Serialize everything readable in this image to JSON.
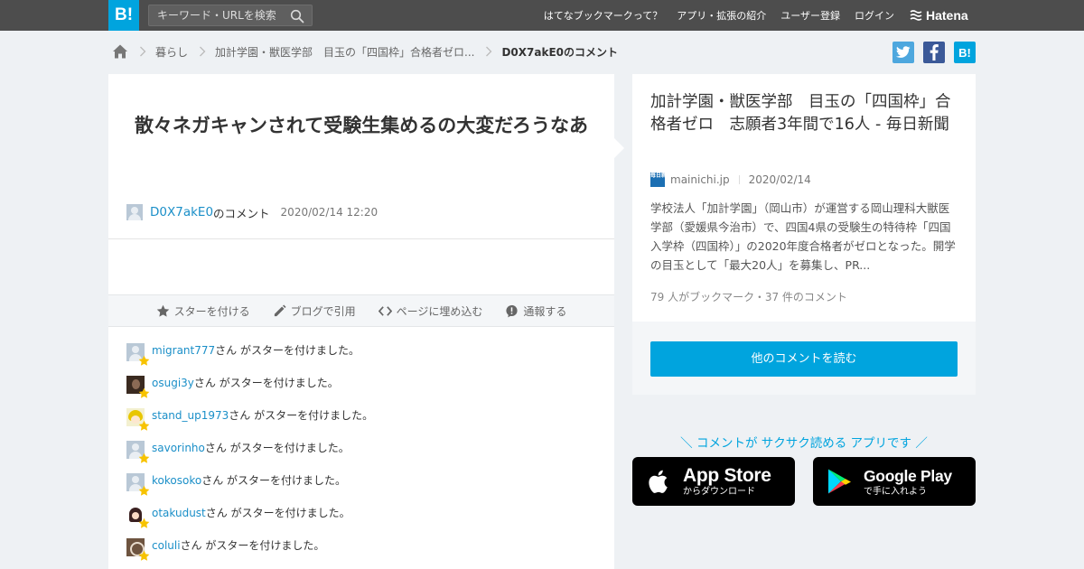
{
  "header": {
    "logo": "B!",
    "search_placeholder": "キーワード・URLを検索",
    "nav": [
      "はてなブックマークって？",
      "アプリ・拡張の紹介",
      "ユーザー登録",
      "ログイン"
    ],
    "brand": "Hatena"
  },
  "breadcrumb": {
    "items": [
      "暮らし",
      "加計学園・獣医学部　目玉の「四国枠」合格者ゼロ..."
    ],
    "current": "D0X7akE0のコメント"
  },
  "share": {
    "hatena": "B!"
  },
  "comment": {
    "text": "散々ネガキャンされて受験生集めるの大変だろうなあ",
    "author": "D0X7akE0",
    "author_suffix": "のコメント",
    "date": "2020/02/14 12:20"
  },
  "actions": {
    "star": "スターを付ける",
    "blog": "ブログで引用",
    "embed": "ページに埋め込む",
    "report": "通報する"
  },
  "stars": {
    "suffix": "さん がスターを付けました。",
    "users": [
      {
        "name": "migrant777",
        "avatar": "default"
      },
      {
        "name": "osugi3y",
        "avatar": "dark"
      },
      {
        "name": "stand_up1973",
        "avatar": "yellow"
      },
      {
        "name": "savorinho",
        "avatar": "default"
      },
      {
        "name": "kokosoko",
        "avatar": "default"
      },
      {
        "name": "otakudust",
        "avatar": "girl"
      },
      {
        "name": "coluli",
        "avatar": "brown"
      }
    ]
  },
  "entry": {
    "title": "加計学園・獣医学部　目玉の「四国枠」合格者ゼロ　志願者3年間で16人 - 毎日新聞",
    "favicon_text": "毎日新聞",
    "domain": "mainichi.jp",
    "date": "2020/02/14",
    "description": "学校法人「加計学園」（岡山市）が運営する岡山理科大獣医学部（愛媛県今治市）で、四国4県の受験生の特待枠「四国入学枠（四国枠）」の2020年度合格者がゼロとなった。開学の目玉として「最大20人」を募集し、PR...",
    "stats": "79 人がブックマーク・37 件のコメント",
    "read_more": "他のコメントを読む"
  },
  "promo": {
    "text": "＼ コメントが サクサク読める アプリです ／",
    "apple_main": "App Store",
    "apple_sub": "からダウンロード",
    "google_main": "Google Play",
    "google_sub": "で手に入れよう"
  },
  "colors": {
    "accent": "#00a4de",
    "header": "#4d4d4d",
    "link": "#1b8fc8",
    "star": "#f7c300"
  }
}
